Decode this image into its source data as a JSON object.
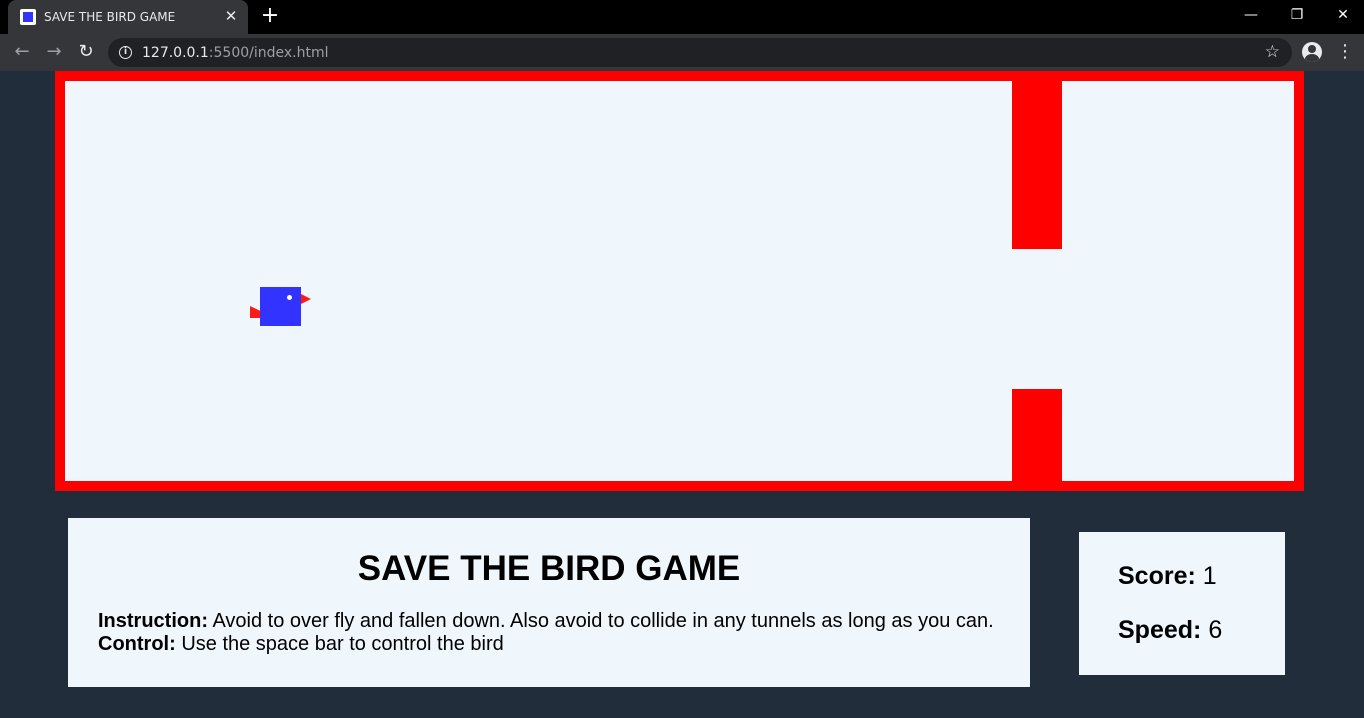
{
  "browser": {
    "tab_title": "SAVE THE BIRD GAME",
    "tab_close": "✕",
    "new_tab": "+",
    "url_host": "127.0.0.1",
    "url_rest": ":5500/index.html",
    "win_minimize": "—",
    "win_restore": "❐",
    "win_close": "✕",
    "back": "←",
    "forward": "→",
    "reload": "↻",
    "info": "i",
    "star": "☆",
    "menu": "⋮"
  },
  "game": {
    "title": "SAVE THE BIRD GAME",
    "instruction_label": "Instruction:",
    "instruction_text": " Avoid to over fly and fallen down. Also avoid to collide in any tunnels as long as you can.",
    "control_label": "Control:",
    "control_text": " Use the space bar to control the bird",
    "score_label": "Score:",
    "score_value": "1",
    "speed_label": "Speed:",
    "speed_value": "6"
  },
  "colors": {
    "background": "#212d3b",
    "border": "#ff0000",
    "canvas": "#eff7fd",
    "bird": "#3333ff",
    "pipe": "#ff0000"
  }
}
